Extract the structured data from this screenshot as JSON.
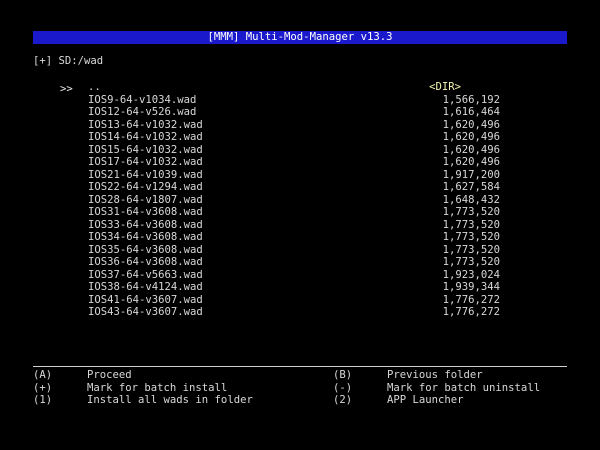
{
  "title": "[MMM] Multi-Mod-Manager v13.3",
  "path": "[+] SD:/wad",
  "cursor": ">>",
  "files": [
    {
      "name": "..",
      "size": "<DIR>"
    },
    {
      "name": "IOS9-64-v1034.wad",
      "size": "1,566,192"
    },
    {
      "name": "IOS12-64-v526.wad",
      "size": "1,616,464"
    },
    {
      "name": "IOS13-64-v1032.wad",
      "size": "1,620,496"
    },
    {
      "name": "IOS14-64-v1032.wad",
      "size": "1,620,496"
    },
    {
      "name": "IOS15-64-v1032.wad",
      "size": "1,620,496"
    },
    {
      "name": "IOS17-64-v1032.wad",
      "size": "1,620,496"
    },
    {
      "name": "IOS21-64-v1039.wad",
      "size": "1,917,200"
    },
    {
      "name": "IOS22-64-v1294.wad",
      "size": "1,627,584"
    },
    {
      "name": "IOS28-64-v1807.wad",
      "size": "1,648,432"
    },
    {
      "name": "IOS31-64-v3608.wad",
      "size": "1,773,520"
    },
    {
      "name": "IOS33-64-v3608.wad",
      "size": "1,773,520"
    },
    {
      "name": "IOS34-64-v3608.wad",
      "size": "1,773,520"
    },
    {
      "name": "IOS35-64-v3608.wad",
      "size": "1,773,520"
    },
    {
      "name": "IOS36-64-v3608.wad",
      "size": "1,773,520"
    },
    {
      "name": "IOS37-64-v5663.wad",
      "size": "1,923,024"
    },
    {
      "name": "IOS38-64-v4124.wad",
      "size": "1,939,344"
    },
    {
      "name": "IOS41-64-v3607.wad",
      "size": "1,776,272"
    },
    {
      "name": "IOS43-64-v3607.wad",
      "size": "1,776,272"
    }
  ],
  "legend_left": [
    {
      "key": "(A)",
      "label": "Proceed"
    },
    {
      "key": "(+)",
      "label": "Mark for batch install"
    },
    {
      "key": "(1)",
      "label": "Install all wads in folder"
    }
  ],
  "legend_right": [
    {
      "key": "(B)",
      "label": "Previous folder"
    },
    {
      "key": "(-)",
      "label": "Mark for batch uninstall"
    },
    {
      "key": "(2)",
      "label": "APP Launcher"
    }
  ],
  "colors": {
    "background": "#000000",
    "title_bar": "#1a1acc",
    "text": "#d8d8d8",
    "dir_label": "#f4f4b0"
  }
}
